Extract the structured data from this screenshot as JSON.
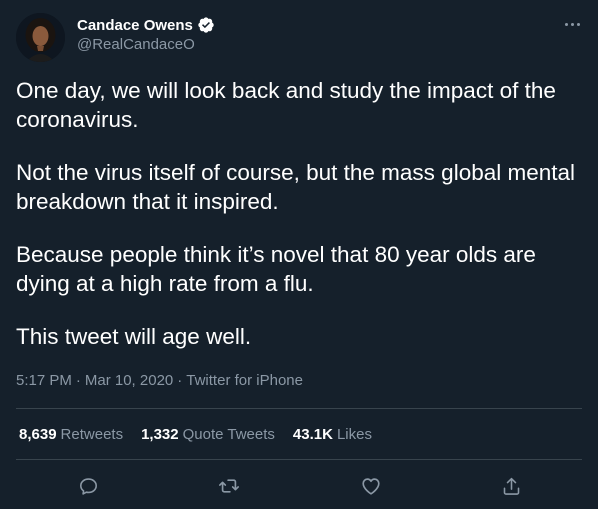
{
  "author": {
    "display_name": "Candace Owens",
    "handle": "@RealCandaceO",
    "verified": true,
    "avatar_icon": "profile-photo-icon"
  },
  "tweet": {
    "paragraphs": [
      "One day, we will look back and study the impact of the coronavirus.",
      "Not the virus itself of course, but the mass global mental breakdown that it inspired.",
      "Because people think it’s novel that 80 year olds are dying at a high rate from a flu.",
      "This tweet will age well."
    ],
    "time": "5:17 PM",
    "separator": "·",
    "date": "Mar 10, 2020",
    "source": "Twitter for iPhone"
  },
  "stats": {
    "retweets": {
      "count": "8,639",
      "label": "Retweets"
    },
    "quote_tweets": {
      "count": "1,332",
      "label": "Quote Tweets"
    },
    "likes": {
      "count": "43.1K",
      "label": "Likes"
    }
  },
  "actions": {
    "reply_icon": "reply-icon",
    "retweet_icon": "retweet-icon",
    "like_icon": "heart-icon",
    "share_icon": "share-icon"
  },
  "colors": {
    "background": "#15202b",
    "text_primary": "#ffffff",
    "text_secondary": "#8b98a5",
    "divider": "#38444d",
    "verified": "#1d9bf0"
  }
}
